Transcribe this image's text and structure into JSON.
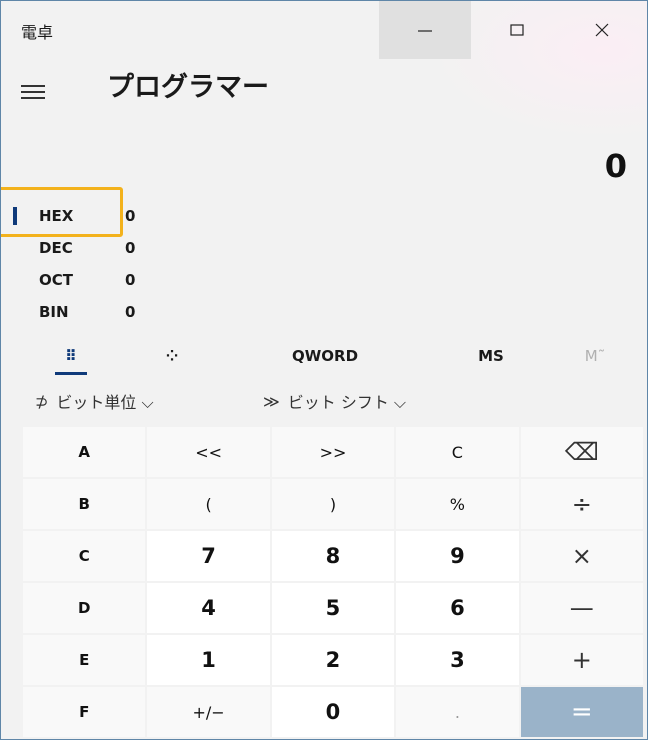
{
  "window": {
    "title": "電卓",
    "controls": {
      "minimize": "—",
      "maximize": "☐",
      "close": "✕"
    }
  },
  "header": {
    "mode": "プログラマー"
  },
  "display": {
    "value": "0"
  },
  "radix": [
    {
      "label": "HEX",
      "value": "0",
      "selected": true
    },
    {
      "label": "DEC",
      "value": "0",
      "selected": false
    },
    {
      "label": "OCT",
      "value": "0",
      "selected": false
    },
    {
      "label": "BIN",
      "value": "0",
      "selected": false
    }
  ],
  "tabs": {
    "keypad_icon": "⠿",
    "bit_toggle_icon": "⁘",
    "word_size": "QWORD",
    "memory_store": "MS",
    "memory_view": "M˜"
  },
  "operations": {
    "bitwise_icon": "⊅",
    "bitwise_label": "ビット単位 ⌵",
    "shift_icon": "≫",
    "shift_label": "ビット シフト ⌵"
  },
  "keys": [
    [
      "A",
      "<<",
      ">>",
      "C",
      "⌫"
    ],
    [
      "B",
      "(",
      ")",
      "%",
      "÷"
    ],
    [
      "C",
      "7",
      "8",
      "9",
      "×"
    ],
    [
      "D",
      "4",
      "5",
      "6",
      "—"
    ],
    [
      "E",
      "1",
      "2",
      "3",
      "+"
    ],
    [
      "F",
      "+/−",
      "0",
      ".",
      "="
    ]
  ],
  "colors": {
    "accent": "#0f3a7a",
    "highlight": "#f3b21c",
    "equals_key": "#9ab3c9"
  }
}
